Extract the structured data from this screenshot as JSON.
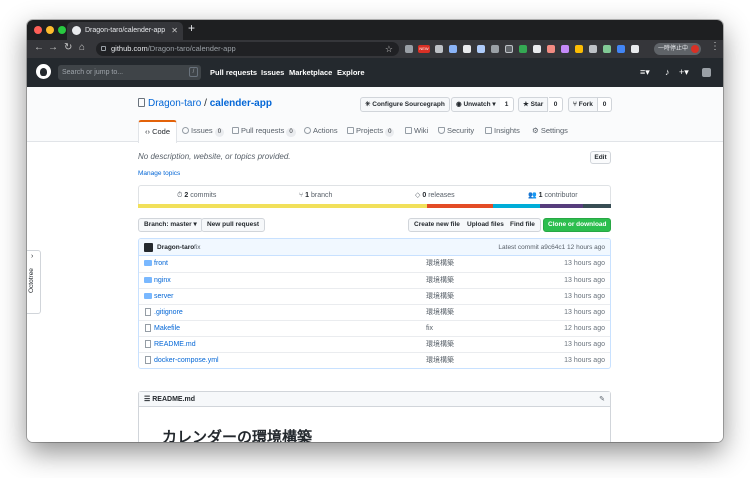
{
  "browser": {
    "tab_title": "Dragon-taro/calender-app",
    "url_host": "github.com",
    "url_path": "/Dragon-taro/calender-app",
    "pause_label": "一時停止中",
    "ext_badge": "NEW"
  },
  "github_header": {
    "search_placeholder": "Search or jump to...",
    "search_shortcut": "/",
    "nav": [
      "Pull requests",
      "Issues",
      "Marketplace",
      "Explore"
    ]
  },
  "repo": {
    "owner": "Dragon-taro",
    "separator": "/",
    "name": "calender-app",
    "sourcegraph_label": "Configure Sourcegraph",
    "unwatch_label": "Unwatch",
    "unwatch_count": "1",
    "star_label": "Star",
    "star_count": "0",
    "fork_label": "Fork",
    "fork_count": "0"
  },
  "tabs": [
    {
      "label": "Code",
      "count": ""
    },
    {
      "label": "Issues",
      "count": "0"
    },
    {
      "label": "Pull requests",
      "count": "0"
    },
    {
      "label": "Actions",
      "count": ""
    },
    {
      "label": "Projects",
      "count": "0"
    },
    {
      "label": "Wiki",
      "count": ""
    },
    {
      "label": "Security",
      "count": ""
    },
    {
      "label": "Insights",
      "count": ""
    },
    {
      "label": "Settings",
      "count": ""
    }
  ],
  "description": "No description, website, or topics provided.",
  "manage_topics": "Manage topics",
  "edit_label": "Edit",
  "summary": {
    "commits_num": "2",
    "commits_label": "commits",
    "branch_num": "1",
    "branch_label": "branch",
    "releases_num": "0",
    "releases_label": "releases",
    "contributor_num": "1",
    "contributor_label": "contributor"
  },
  "language_colors": [
    "#f1e05a",
    "#e34c26",
    "#00add8",
    "#563d7c",
    "#384d54"
  ],
  "language_fractions": [
    0.61,
    0.14,
    0.1,
    0.09,
    0.06
  ],
  "file_actions": {
    "branch_label": "Branch: master ▾",
    "new_pr": "New pull request",
    "create_file": "Create new file",
    "upload_files": "Upload files",
    "find_file": "Find file",
    "clone": "Clone or download ▾"
  },
  "latest_commit": {
    "author": "Dragon-taro",
    "message": "fix",
    "label": "Latest commit a9c64c1 12 hours ago"
  },
  "files": [
    {
      "name": "front",
      "type": "dir",
      "message": "環境構築",
      "age": "13 hours ago"
    },
    {
      "name": "nginx",
      "type": "dir",
      "message": "環境構築",
      "age": "13 hours ago"
    },
    {
      "name": "server",
      "type": "dir",
      "message": "環境構築",
      "age": "13 hours ago"
    },
    {
      "name": ".gitignore",
      "type": "file",
      "message": "環境構築",
      "age": "13 hours ago"
    },
    {
      "name": "Makefile",
      "type": "file",
      "message": "fix",
      "age": "12 hours ago"
    },
    {
      "name": "README.md",
      "type": "file",
      "message": "環境構築",
      "age": "13 hours ago"
    },
    {
      "name": "docker-compose.yml",
      "type": "file",
      "message": "環境構築",
      "age": "13 hours ago"
    }
  ],
  "readme": {
    "filename": "README.md",
    "heading": "カレンダーの環境構築"
  },
  "octotree": {
    "label": "Octotree",
    "chevron": "›"
  }
}
